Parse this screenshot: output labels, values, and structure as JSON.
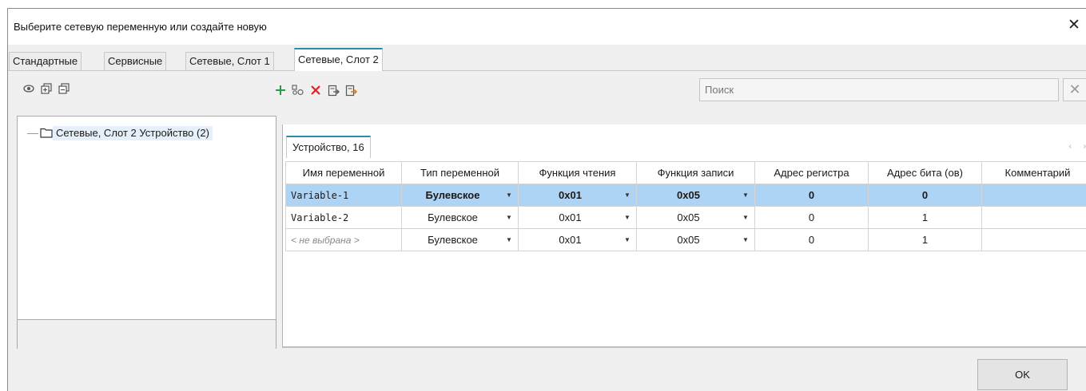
{
  "dialog": {
    "title": "Выберите сетевую переменную или создайте новую",
    "close_glyph": "✕"
  },
  "tabs": [
    {
      "label": "Стандартные"
    },
    {
      "label": "Сервисные"
    },
    {
      "label": "Сетевые, Слот 1"
    },
    {
      "label": "Сетевые, Слот 2",
      "active": true
    }
  ],
  "toolbar_left": [
    "view-icon",
    "expand-all-icon",
    "collapse-all-icon"
  ],
  "toolbar_mid": [
    "add-icon",
    "add-group-icon",
    "delete-icon",
    "import-icon",
    "export-icon"
  ],
  "search": {
    "placeholder": "Поиск",
    "value": "",
    "clear_glyph": "✕"
  },
  "tree": {
    "items": [
      {
        "label": "Сетевые, Слот 2 Устройство (2)",
        "icon": "folder-icon"
      }
    ]
  },
  "device_tab": {
    "label": "Устройство, 16"
  },
  "scroll_arrows": "‹ ›",
  "table": {
    "columns": [
      "Имя переменной",
      "Тип переменной",
      "Функция чтения",
      "Функция записи",
      "Адрес регистра",
      "Адрес бита (ов)",
      "Комментарий"
    ],
    "rows": [
      {
        "name": "Variable-1",
        "type": "Булевское",
        "read": "0x01",
        "write": "0x05",
        "reg": "0",
        "bit": "0",
        "comment": "",
        "selected": true
      },
      {
        "name": "Variable-2",
        "type": "Булевское",
        "read": "0x01",
        "write": "0x05",
        "reg": "0",
        "bit": "1",
        "comment": ""
      },
      {
        "name": "< не выбрана >",
        "type": "Булевское",
        "read": "0x01",
        "write": "0x05",
        "reg": "0",
        "bit": "1",
        "comment": "",
        "placeholder": true
      }
    ]
  },
  "buttons": {
    "ok": "OK"
  },
  "colors": {
    "accent": "#2a8fa6",
    "selection": "#aed4f5",
    "delete": "#e02020",
    "add": "#2a9a4a",
    "export": "#e07a10"
  }
}
